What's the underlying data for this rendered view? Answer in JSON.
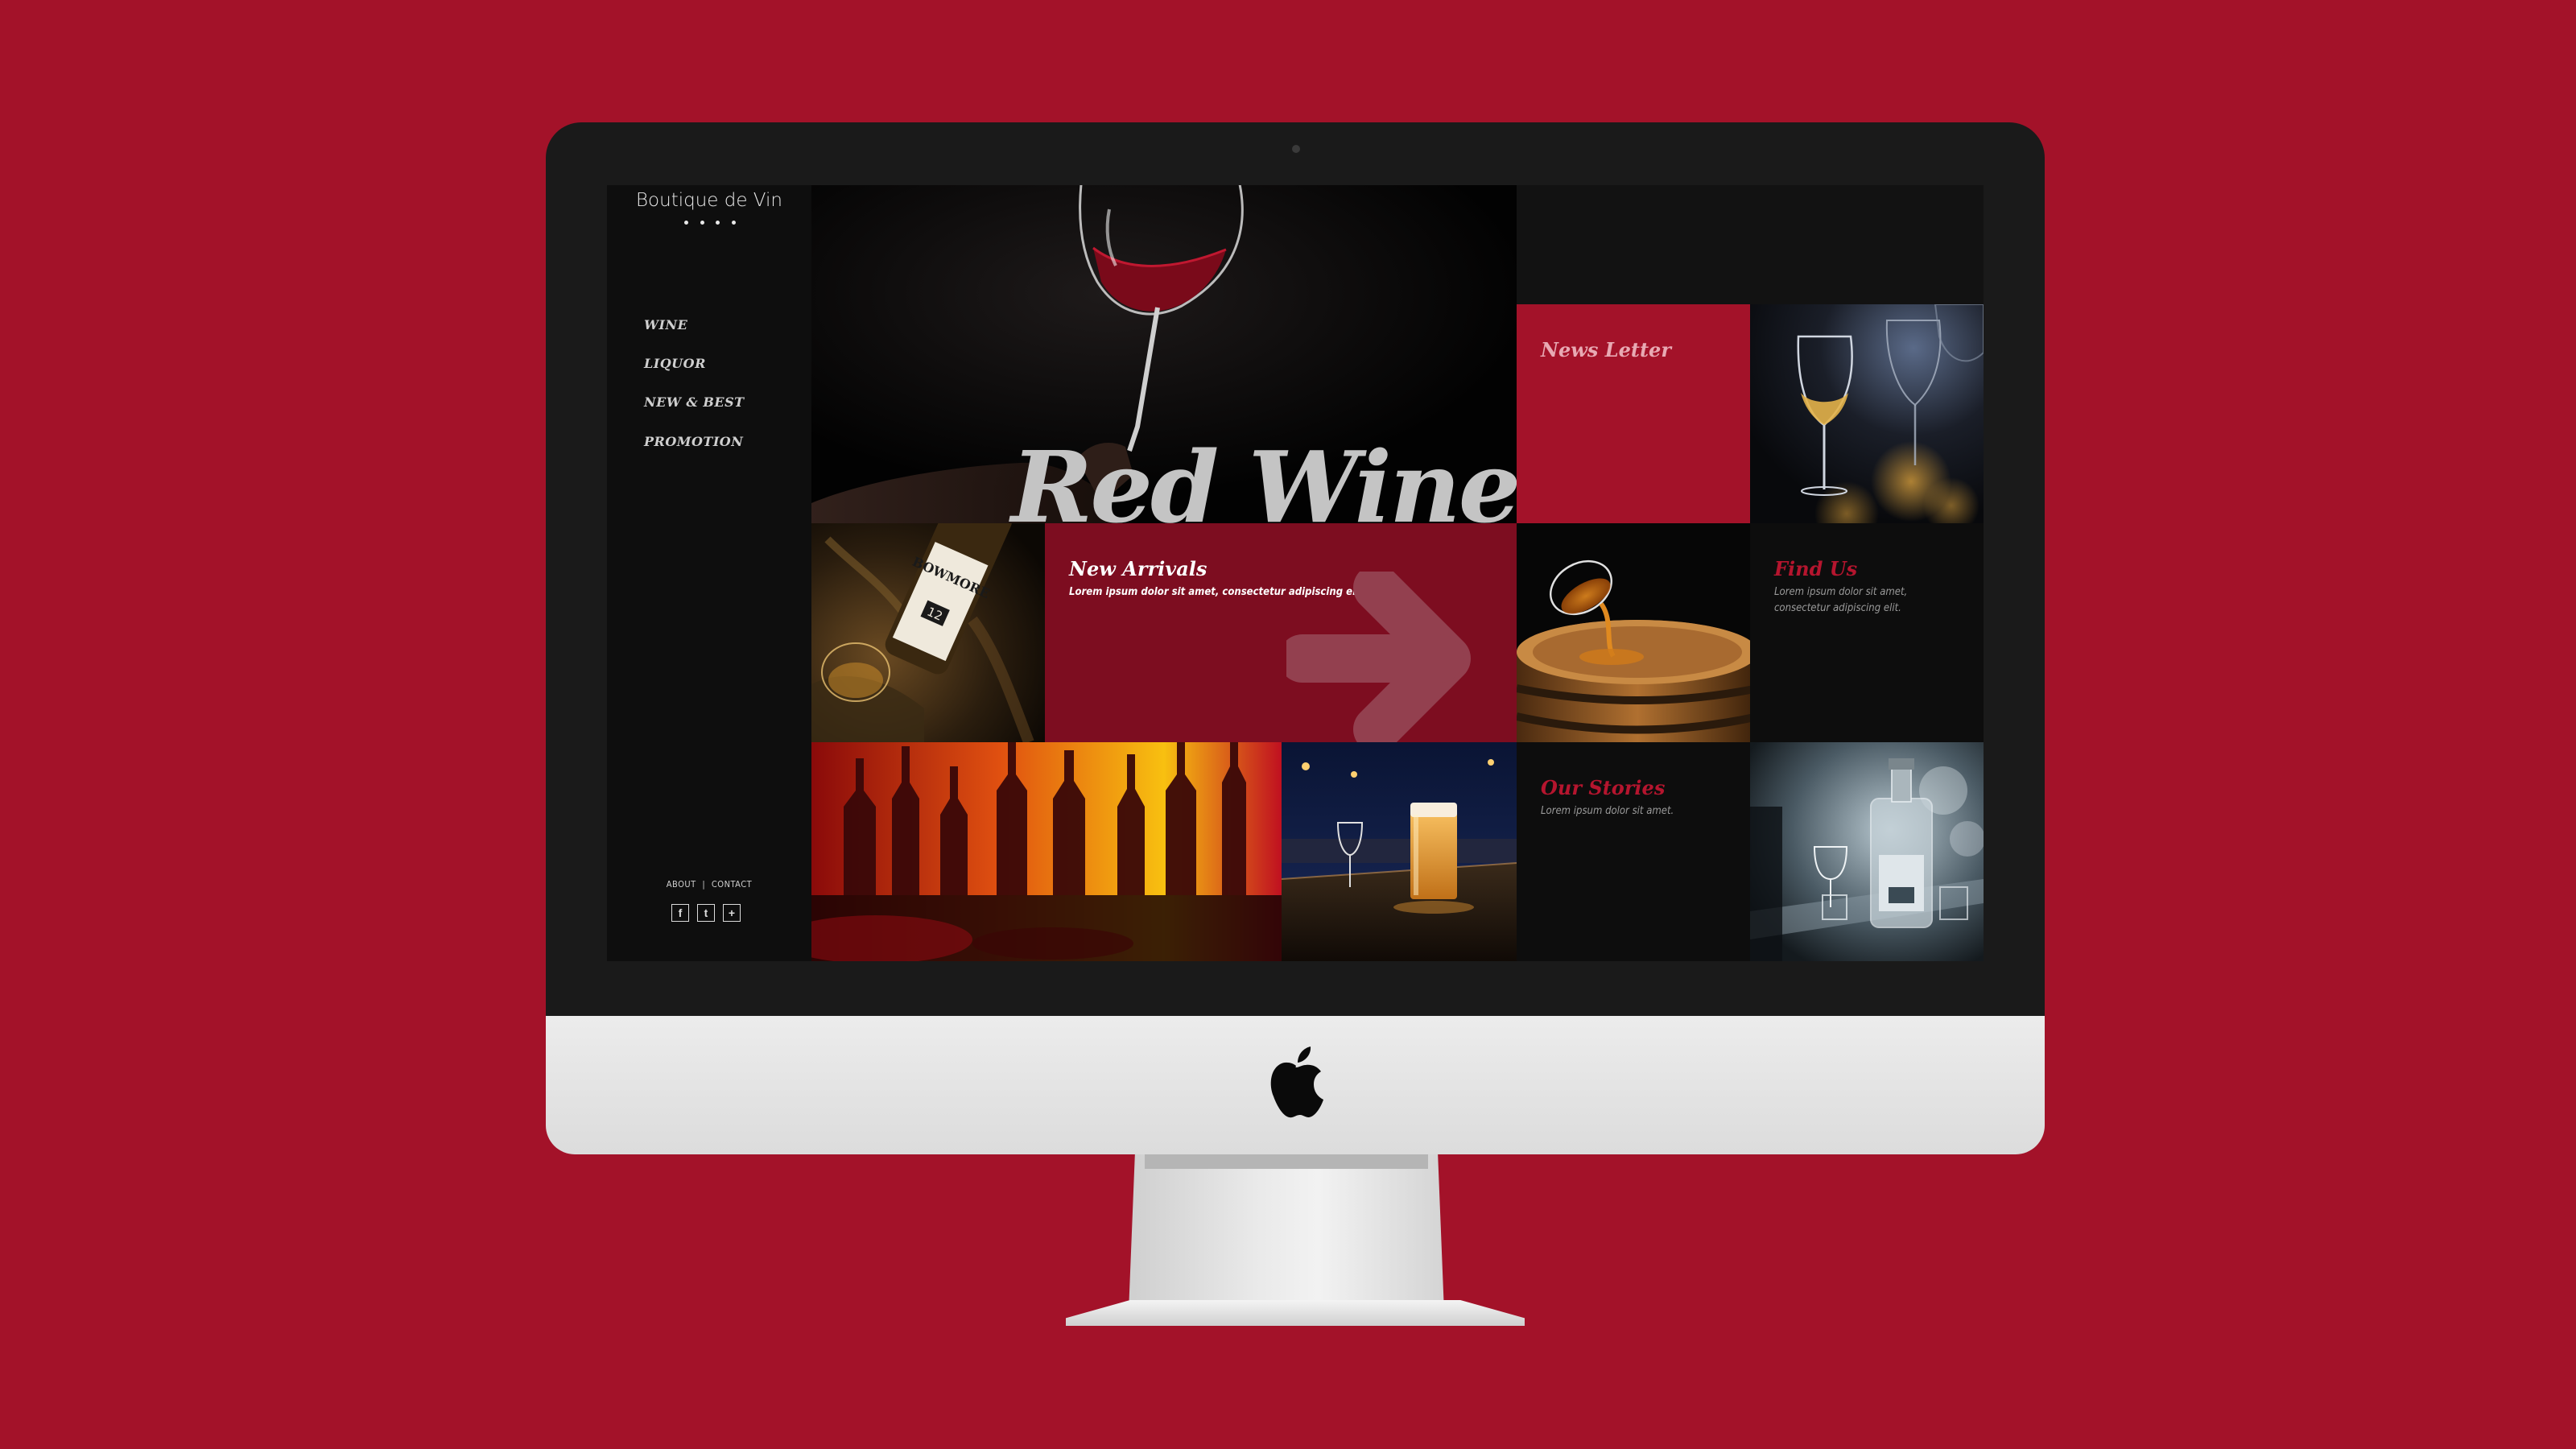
{
  "sidebar": {
    "brand": "Boutique de Vin",
    "nav": [
      "WINE",
      "LIQUOR",
      "NEW & BEST",
      "PROMOTION"
    ],
    "footer_links": [
      "ABOUT",
      "CONTACT"
    ],
    "socials": [
      "f",
      "t",
      "+"
    ]
  },
  "hero": {
    "title": "Red Wine"
  },
  "tiles": {
    "newsletter": {
      "title": "News Letter"
    },
    "new_arrivals": {
      "title": "New Arrivals",
      "text": "Lorem ipsum dolor sit amet, consectetur adipiscing elit."
    },
    "find_us": {
      "title": "Find Us",
      "text_line1": "Lorem ipsum dolor sit amet,",
      "text_line2": "consectetur adipiscing elit."
    },
    "our_stories": {
      "title": "Our Stories",
      "text": "Lorem ipsum dolor sit amet."
    }
  },
  "bottle_label": {
    "brand": "BOWMORE",
    "age": "12"
  },
  "colors": {
    "background": "#a31229",
    "accent_red": "#a31229",
    "dark_red": "#7d0d20",
    "screen_bg": "#111111"
  }
}
